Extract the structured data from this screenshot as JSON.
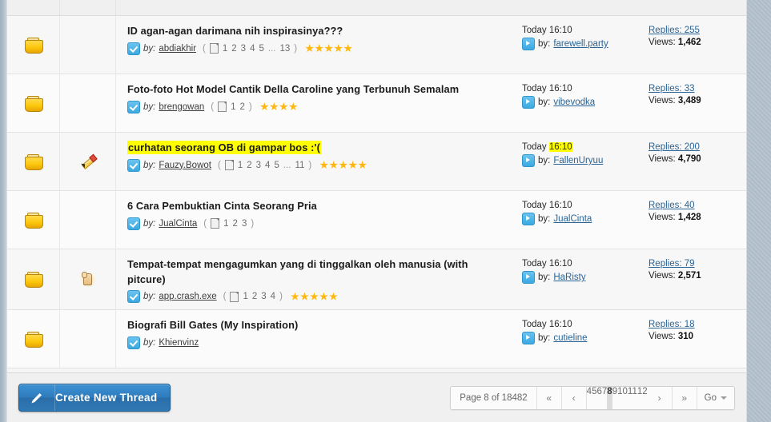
{
  "colors": {
    "accent_link": "#2a6496",
    "highlight": "#ffff00",
    "button_blue": "#2f7cbd",
    "folder_yellow": "#fcc70d",
    "star_orange": "#fcb711"
  },
  "labels": {
    "by": "by:",
    "by_last": "by:",
    "replies_prefix": "Replies:",
    "views_prefix": "Views:",
    "paren_open": "(",
    "paren_close": ")",
    "ellipsis": "..."
  },
  "threads": [
    {
      "status_icon": "folder-icon",
      "flag_icon": "",
      "title": "ID agan-agan darimana nih inspirasinya???",
      "title_highlighted": false,
      "author": "abdiakhir",
      "pages": [
        "1",
        "2",
        "3",
        "4",
        "5"
      ],
      "pages_truncated": true,
      "pages_last": "13",
      "stars": 5,
      "last_post_time": "Today 16:10",
      "last_post_time_highlighted": false,
      "last_post_author": "farewell.party",
      "replies": "Replies: 255",
      "views_value": "1,462"
    },
    {
      "status_icon": "folder-icon",
      "flag_icon": "",
      "title": "Foto-foto Hot Model Cantik Della Caroline yang Terbunuh Semalam",
      "title_highlighted": false,
      "author": "brengowan",
      "pages": [
        "1",
        "2"
      ],
      "pages_truncated": false,
      "pages_last": "",
      "stars": 4,
      "last_post_time": "Today 16:10",
      "last_post_time_highlighted": false,
      "last_post_author": "vibevodka",
      "replies": "Replies: 33",
      "views_value": "3,489"
    },
    {
      "status_icon": "folder-icon",
      "flag_icon": "pencil-icon",
      "title": "curhatan seorang OB di gampar bos :'(",
      "title_highlighted": true,
      "author": "Fauzy.Bowot",
      "pages": [
        "1",
        "2",
        "3",
        "4",
        "5"
      ],
      "pages_truncated": true,
      "pages_last": "11",
      "stars": 5,
      "last_post_time_prefix": "Today ",
      "last_post_time_hl": "16:10",
      "last_post_time": "Today 16:10",
      "last_post_time_highlighted": true,
      "last_post_author": "FallenUryuu",
      "replies": "Replies: 200",
      "views_value": "4,790"
    },
    {
      "status_icon": "folder-icon",
      "flag_icon": "",
      "title": "6 Cara Pembuktian Cinta Seorang Pria",
      "title_highlighted": false,
      "author": "JualCinta",
      "pages": [
        "1",
        "2",
        "3"
      ],
      "pages_truncated": false,
      "pages_last": "",
      "stars": 0,
      "last_post_time": "Today 16:10",
      "last_post_time_highlighted": false,
      "last_post_author": "JualCinta",
      "replies": "Replies: 40",
      "views_value": "1,428"
    },
    {
      "status_icon": "folder-icon",
      "flag_icon": "hot-icon",
      "title": "Tempat-tempat mengagumkan yang di tinggalkan oleh manusia (with pitcure)",
      "title_highlighted": false,
      "author": "app.crash.exe",
      "pages": [
        "1",
        "2",
        "3",
        "4"
      ],
      "pages_truncated": false,
      "pages_last": "",
      "stars": 5,
      "last_post_time": "Today 16:10",
      "last_post_time_highlighted": false,
      "last_post_author": "HaRisty",
      "replies": "Replies: 79",
      "views_value": "2,571"
    },
    {
      "status_icon": "folder-icon",
      "flag_icon": "",
      "title": "Biografi Bill Gates (My Inspiration)",
      "title_highlighted": false,
      "author": "Khienvinz",
      "pages": [],
      "pages_truncated": false,
      "pages_last": "",
      "stars": 0,
      "last_post_time": "Today 16:10",
      "last_post_time_highlighted": false,
      "last_post_author": "cutieline",
      "replies": "Replies: 18",
      "views_value": "310"
    }
  ],
  "footer": {
    "create_thread_label": "Create New Thread",
    "pager": {
      "page_info": "Page 8 of 18482",
      "first_glyph": "«",
      "prev_glyph": "‹",
      "numbers": [
        "4",
        "5",
        "6",
        "7",
        "8",
        "9",
        "10",
        "11",
        "12"
      ],
      "current": "8",
      "next_glyph": "›",
      "last_glyph": "»",
      "go_label": "Go"
    }
  }
}
